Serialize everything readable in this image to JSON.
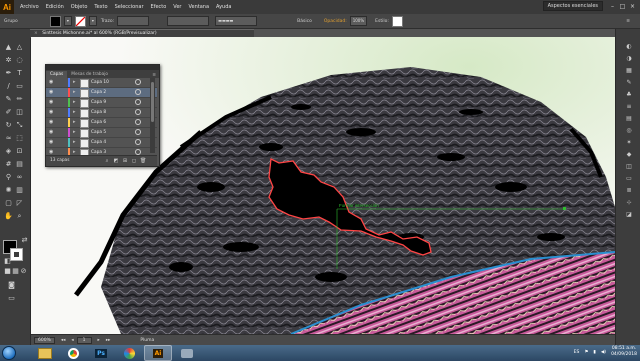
{
  "app": {
    "logo": "Ai",
    "workspace": "Aspectos esenciales"
  },
  "menu": [
    "Archivo",
    "Edición",
    "Objeto",
    "Texto",
    "Seleccionar",
    "Efecto",
    "Ver",
    "Ventana",
    "Ayuda"
  ],
  "control_bar": {
    "label": "Grupo",
    "stroke_label": "Trazo:",
    "opacity_label": "Opacidad:",
    "opacity_value": "100%",
    "style_label": "Estilo:",
    "basic_label": "Básico",
    "fill_color": "#000000",
    "stroke_color": "#ffffff"
  },
  "document_tab": {
    "title": "Sinttesis Michonne.ai* al 600% (RGB/Previsualizar)",
    "close": "×"
  },
  "layers_panel": {
    "tabs": [
      "Capas",
      "Mesas de trabajo"
    ],
    "layers": [
      {
        "name": "Capa 10",
        "color": "#4f7cff",
        "selected": false
      },
      {
        "name": "Capa 2",
        "color": "#ff4f4f",
        "selected": true
      },
      {
        "name": "Capa 9",
        "color": "#4fbf4f",
        "selected": false
      },
      {
        "name": "Capa 8",
        "color": "#4f7cff",
        "selected": false
      },
      {
        "name": "Capa 6",
        "color": "#ffcf4f",
        "selected": false
      },
      {
        "name": "Capa 5",
        "color": "#cf4fcf",
        "selected": false
      },
      {
        "name": "Capa 4",
        "color": "#4fbfbf",
        "selected": false
      },
      {
        "name": "Capa 3",
        "color": "#ff8f4f",
        "selected": false
      }
    ],
    "count": "13 capas"
  },
  "canvas": {
    "smart_guide_label": "Formar intersección"
  },
  "status_bar": {
    "zoom": "600%",
    "page": "1",
    "tool": "Pluma"
  },
  "taskbar": {
    "apps": [
      "Explorer",
      "Chrome",
      "Ps",
      "Paint",
      "Ai",
      "Photos"
    ],
    "language": "ES",
    "time": "08:51 a.m.",
    "date": "04/09/2018"
  },
  "icons": {
    "tools_left": [
      "selection-icon",
      "direct-selection-icon",
      "magic-wand-icon",
      "lasso-icon",
      "pen-icon",
      "type-icon",
      "line-icon",
      "rectangle-icon",
      "paintbrush-icon",
      "pencil-icon",
      "blob-brush-icon",
      "eraser-icon",
      "rotate-icon",
      "scale-icon",
      "width-icon",
      "free-transform-icon",
      "shape-builder-icon",
      "perspective-icon",
      "mesh-icon",
      "gradient-icon",
      "eyedropper-icon",
      "blend-icon",
      "symbol-sprayer-icon",
      "graph-icon",
      "artboard-icon",
      "slice-icon",
      "hand-icon",
      "zoom-icon"
    ],
    "panels_right": [
      "color-icon",
      "color-guide-icon",
      "swatches-icon",
      "brushes-icon",
      "symbols-icon",
      "stroke-icon",
      "gradient-panel-icon",
      "transparency-icon",
      "appearance-icon",
      "graphic-styles-icon",
      "layers-panel-icon",
      "artboards-panel-icon",
      "align-icon",
      "transform-icon",
      "pathfinder-icon"
    ]
  }
}
